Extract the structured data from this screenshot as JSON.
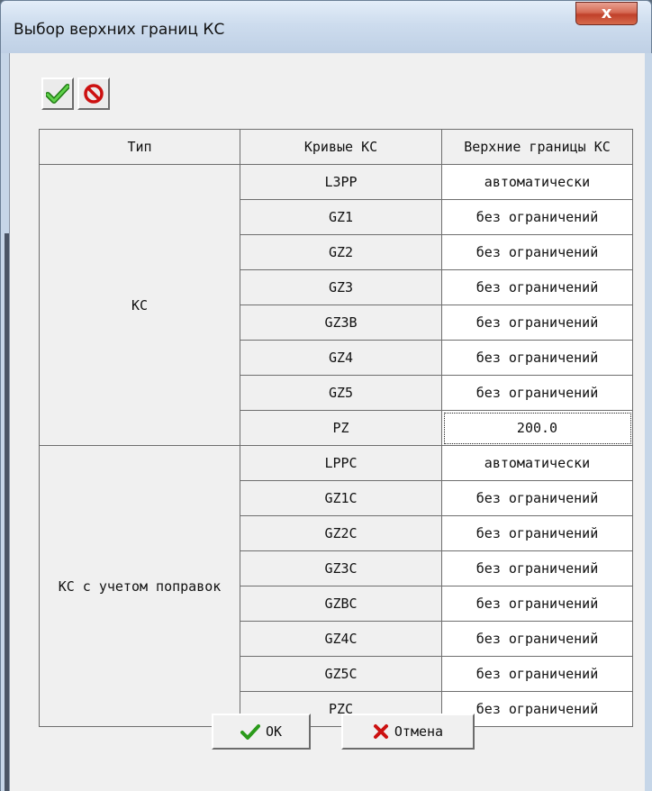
{
  "window": {
    "title": "Выбор верхних границ КС",
    "close_label": "x"
  },
  "toolbar": {
    "apply_icon": "green-check-icon",
    "cancel_icon": "red-prohibit-icon"
  },
  "table": {
    "headers": [
      "Тип",
      "Кривые КС",
      "Верхние границы КС"
    ],
    "groups": [
      {
        "type": "КС",
        "rows": [
          {
            "curve": "L3PP",
            "limit": "автоматически"
          },
          {
            "curve": "GZ1",
            "limit": "без ограничений"
          },
          {
            "curve": "GZ2",
            "limit": "без ограничений"
          },
          {
            "curve": "GZ3",
            "limit": "без ограничений"
          },
          {
            "curve": "GZ3B",
            "limit": "без ограничений"
          },
          {
            "curve": "GZ4",
            "limit": "без ограничений"
          },
          {
            "curve": "GZ5",
            "limit": "без ограничений"
          },
          {
            "curve": "PZ",
            "limit": "200.0"
          }
        ]
      },
      {
        "type": "КС с учетом поправок",
        "rows": [
          {
            "curve": "LPPC",
            "limit": "автоматически"
          },
          {
            "curve": "GZ1C",
            "limit": "без ограничений"
          },
          {
            "curve": "GZ2C",
            "limit": "без ограничений"
          },
          {
            "curve": "GZ3C",
            "limit": "без ограничений"
          },
          {
            "curve": "GZBC",
            "limit": "без ограничений"
          },
          {
            "curve": "GZ4C",
            "limit": "без ограничений"
          },
          {
            "curve": "GZ5C",
            "limit": "без ограничений"
          },
          {
            "curve": "PZC",
            "limit": "без ограничений"
          }
        ]
      }
    ]
  },
  "buttons": {
    "ok_label": "OK",
    "cancel_label": "Отмена",
    "ok_icon": "check-icon",
    "cancel_icon": "x-icon"
  },
  "colors": {
    "check_green": "#2a9a1a",
    "cancel_red": "#cc1111",
    "close_red": "#c0402a"
  }
}
